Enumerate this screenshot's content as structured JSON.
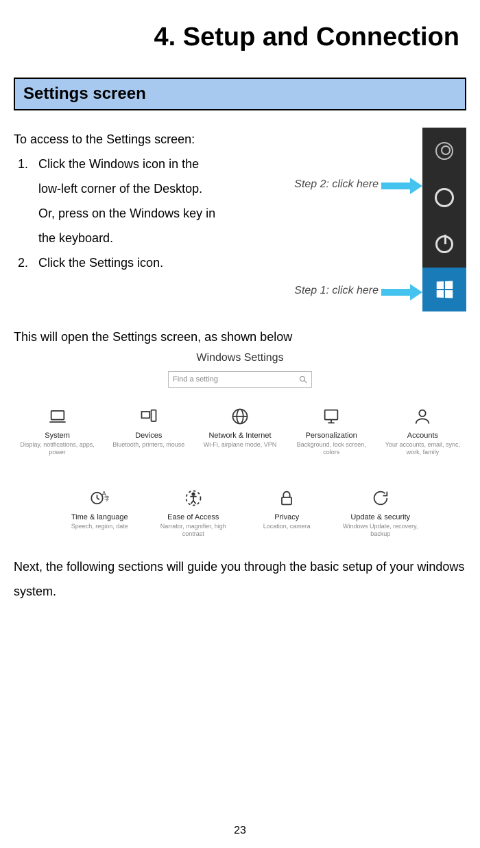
{
  "chapter_title": "4. Setup and Connection",
  "section_heading": "Settings screen",
  "intro_text": "To access to the Settings screen:",
  "steps": [
    "Click the Windows icon in the low-left corner of the Desktop. Or, press on the Windows key in the keyboard.",
    "Click the Settings icon."
  ],
  "callouts": {
    "step2": "Step 2: click here",
    "step1": "Step 1: click here"
  },
  "after_steps": "This will open the Settings screen, as shown below",
  "settings_window": {
    "title": "Windows Settings",
    "search_placeholder": "Find a setting",
    "tiles_row1": [
      {
        "title": "System",
        "desc": "Display, notifications, apps, power"
      },
      {
        "title": "Devices",
        "desc": "Bluetooth, printers, mouse"
      },
      {
        "title": "Network & Internet",
        "desc": "Wi-Fi, airplane mode, VPN"
      },
      {
        "title": "Personalization",
        "desc": "Background, lock screen, colors"
      },
      {
        "title": "Accounts",
        "desc": "Your accounts, email, sync, work, family"
      }
    ],
    "tiles_row2": [
      {
        "title": "Time & language",
        "desc": "Speech, region, date"
      },
      {
        "title": "Ease of Access",
        "desc": "Narrator, magnifier, high contrast"
      },
      {
        "title": "Privacy",
        "desc": "Location, camera"
      },
      {
        "title": "Update & security",
        "desc": "Windows Update, recovery, backup"
      }
    ]
  },
  "closing_text": "Next, the following sections will guide you through the basic setup of your windows system.",
  "page_number": "23"
}
